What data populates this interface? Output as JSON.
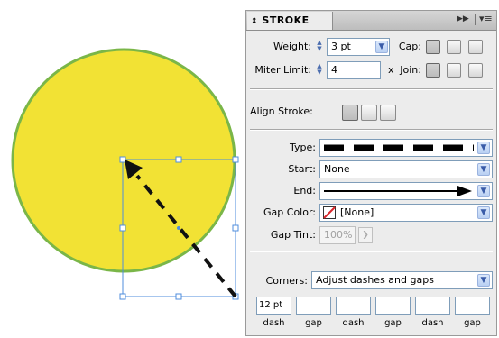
{
  "colors": {
    "circle_fill": "#f2e234",
    "circle_stroke": "#7ab648",
    "selection": "#4f8ddc",
    "panel_bg": "#ececec"
  },
  "panel": {
    "title": "STROKE",
    "title_icon": "double-arrow-icon",
    "weight": {
      "label": "Weight:",
      "value": "3 pt"
    },
    "cap": {
      "label": "Cap:"
    },
    "miter": {
      "label": "Miter Limit:",
      "value": "4",
      "unit": "x"
    },
    "join": {
      "label": "Join:"
    },
    "align": {
      "label": "Align Stroke:"
    },
    "type": {
      "label": "Type:"
    },
    "start": {
      "label": "Start:",
      "value": "None"
    },
    "end": {
      "label": "End:"
    },
    "gap_color": {
      "label": "Gap Color:",
      "value": "[None]"
    },
    "gap_tint": {
      "label": "Gap Tint:",
      "value": "100%"
    },
    "corners": {
      "label": "Corners:",
      "value": "Adjust dashes and gaps"
    },
    "dashes": [
      {
        "value": "12 pt",
        "label": "dash"
      },
      {
        "value": "",
        "label": "gap"
      },
      {
        "value": "",
        "label": "dash"
      },
      {
        "value": "",
        "label": "gap"
      },
      {
        "value": "",
        "label": "dash"
      },
      {
        "value": "",
        "label": "gap"
      }
    ]
  }
}
